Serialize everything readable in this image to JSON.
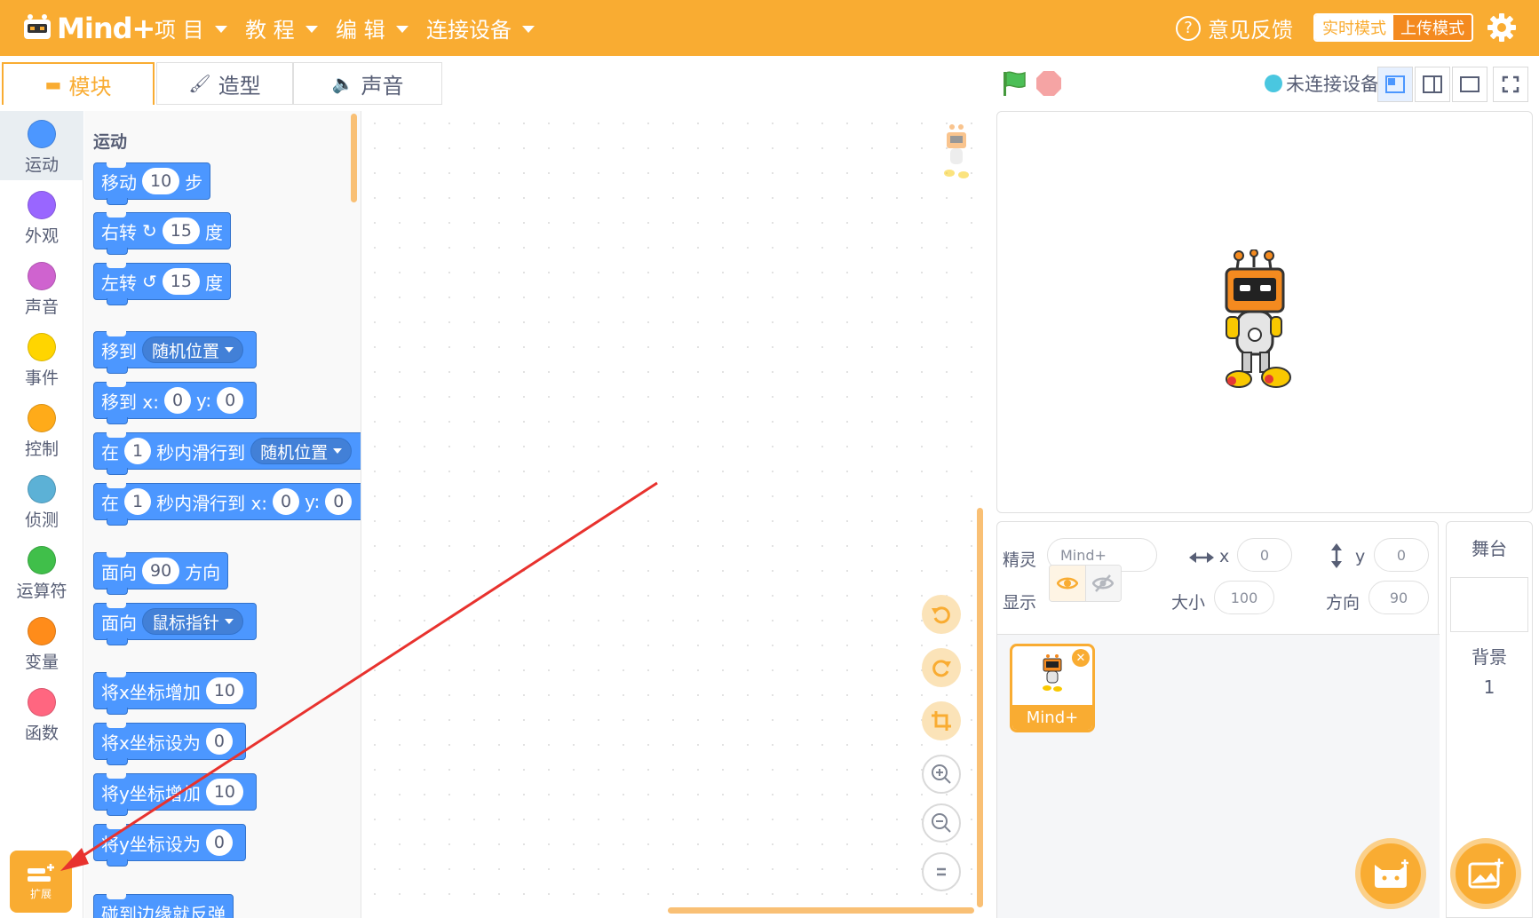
{
  "app": {
    "logo_text": "Mind+",
    "menu": [
      {
        "label": "项 目"
      },
      {
        "label": "教 程"
      },
      {
        "label": "编 辑"
      },
      {
        "label": "连接设备"
      }
    ],
    "feedback_label": "意见反馈",
    "mode_realtime": "实时模式",
    "mode_upload": "上传模式",
    "accent_color": "#f9ac32"
  },
  "tabs": {
    "blocks": "模块",
    "costumes": "造型",
    "sounds": "声音"
  },
  "device": {
    "status": "未连接设备"
  },
  "categories": [
    {
      "label": "运动",
      "color": "#4c97ff"
    },
    {
      "label": "外观",
      "color": "#9966ff"
    },
    {
      "label": "声音",
      "color": "#cf63cf"
    },
    {
      "label": "事件",
      "color": "#ffd500"
    },
    {
      "label": "控制",
      "color": "#ffab19"
    },
    {
      "label": "侦测",
      "color": "#5cb1d6"
    },
    {
      "label": "运算符",
      "color": "#40bf4a"
    },
    {
      "label": "变量",
      "color": "#ff8c1a"
    },
    {
      "label": "函数",
      "color": "#ff6680"
    }
  ],
  "extension_label": "扩展",
  "palette": {
    "section_title": "运动",
    "blocks": {
      "move": {
        "t1": "移动",
        "v1": "10",
        "t2": "步"
      },
      "turn_right": {
        "t1": "右转",
        "v1": "15",
        "t2": "度"
      },
      "turn_left": {
        "t1": "左转",
        "v1": "15",
        "t2": "度"
      },
      "goto": {
        "t1": "移到",
        "d1": "随机位置"
      },
      "goto_xy": {
        "t1": "移到 x:",
        "v1": "0",
        "t2": "y:",
        "v2": "0"
      },
      "glide": {
        "t1": "在",
        "v1": "1",
        "t2": "秒内滑行到",
        "d1": "随机位置"
      },
      "glide_xy": {
        "t1": "在",
        "v1": "1",
        "t2": "秒内滑行到 x:",
        "v2": "0",
        "t3": "y:",
        "v3": "0"
      },
      "point_dir": {
        "t1": "面向",
        "v1": "90",
        "t2": "方向"
      },
      "point_towards": {
        "t1": "面向",
        "d1": "鼠标指针"
      },
      "change_x": {
        "t1": "将x坐标增加",
        "v1": "10"
      },
      "set_x": {
        "t1": "将x坐标设为",
        "v1": "0"
      },
      "change_y": {
        "t1": "将y坐标增加",
        "v1": "10"
      },
      "set_y": {
        "t1": "将y坐标设为",
        "v1": "0"
      },
      "bounce": {
        "t1": "碰到边缘就反弹"
      }
    }
  },
  "sprite_info": {
    "sprite_label": "精灵",
    "sprite_name": "Mind+",
    "x_label": "x",
    "x_value": "0",
    "y_label": "y",
    "y_value": "0",
    "show_label": "显示",
    "size_label": "大小",
    "size_value": "100",
    "direction_label": "方向",
    "direction_value": "90"
  },
  "sprites": [
    {
      "name": "Mind+"
    }
  ],
  "stage_panel": {
    "title": "舞台",
    "backdrop_label": "背景",
    "backdrop_count": "1"
  }
}
